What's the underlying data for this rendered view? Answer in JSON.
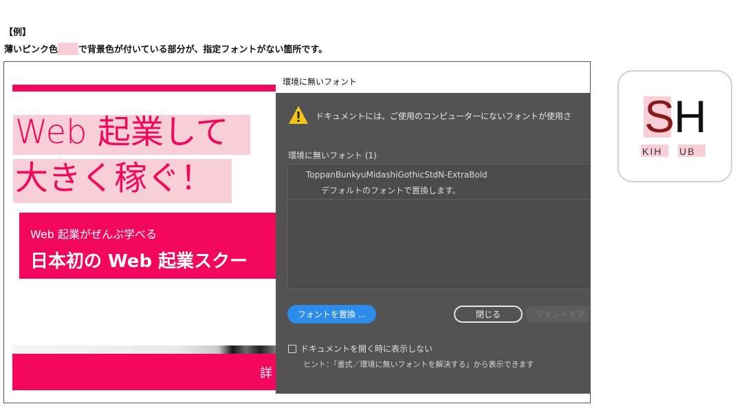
{
  "caption": {
    "line1": "【例】",
    "line2_before": "薄いピンク色",
    "line2_after": "で背景色が付いている部分が、指定フォントがない箇所です。"
  },
  "canvas": {
    "headline_line1": "Web 起業して",
    "headline_line2": "大きく稼ぐ！",
    "band_sub": "Web 起業がぜんぶ学べる",
    "band_main": "日本初の Web 起業スクー",
    "cta_label": "詳"
  },
  "dialog": {
    "title": "環境に無いフォント",
    "warning": "ドキュメントには、ご使用のコンピューターにないフォントが使用さ",
    "section_label": "環境に無いフォント (1)",
    "font_name": "ToppanBunkyuMidashiGothicStdN-ExtraBold",
    "font_action": "デフォルトのフォントで置換します。",
    "replace_button": "フォントを置換 ...",
    "close_button": "閉じる",
    "activate_button": "フォントをア",
    "checkbox_label": "ドキュメントを開く時に表示しない",
    "hint": "ヒント：「書式／環境に無いフォントを解決する」から表示できます"
  },
  "sh_icon": {
    "letter_s": "S",
    "letter_h": "H",
    "sub_left": "KIH",
    "sub_right": "UB"
  },
  "colors": {
    "brand_pink": "#f2075d",
    "missing_font_highlight": "#f8cfd6",
    "dialog_bg": "#535353",
    "primary_button": "#2d8ceb",
    "warning_yellow": "#f5c518"
  }
}
